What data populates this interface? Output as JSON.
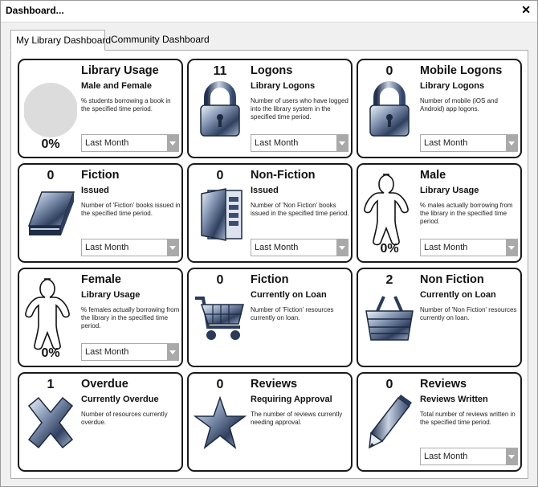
{
  "window": {
    "title": "Dashboard...",
    "close_glyph": "✕"
  },
  "tabs": [
    {
      "label": "My Library Dashboard",
      "active": true
    },
    {
      "label": "Community Dashboard",
      "active": false
    }
  ],
  "colors": {
    "card_border": "#1a1a1a",
    "icon_steel": "#3a4d6e",
    "pie_gray": "#dcdcdc",
    "dropdown_button": "#a9a9a9"
  },
  "cards": [
    {
      "title": "Library Usage",
      "subtitle": "Male and Female",
      "description": "% students borrowing a book in the specified time period.",
      "percent": "0%",
      "icon": "pie-chart-icon",
      "dropdown": "Last Month"
    },
    {
      "title": "Logons",
      "subtitle": "Library Logons",
      "description": "Number of users who have logged into the library system in the specified time period.",
      "count": "11",
      "icon": "padlock-icon",
      "dropdown": "Last Month"
    },
    {
      "title": "Mobile Logons",
      "subtitle": "Library Logons",
      "description": "Number of mobile (iOS and Android) app logons.",
      "count": "0",
      "icon": "padlock-icon",
      "dropdown": "Last Month"
    },
    {
      "title": "Fiction",
      "subtitle": "Issued",
      "description": "Number of 'Fiction' books issued in the specified time period.",
      "count": "0",
      "icon": "book-icon",
      "dropdown": "Last Month"
    },
    {
      "title": "Non-Fiction",
      "subtitle": "Issued",
      "description": "Number of 'Non Fiction' books issued in the specified time period.",
      "count": "0",
      "icon": "binder-icon",
      "dropdown": "Last Month"
    },
    {
      "title": "Male",
      "subtitle": "Library Usage",
      "description": "% males actually borrowing from the library in the specified time period.",
      "percent": "0%",
      "icon": "person-outline-icon",
      "dropdown": "Last Month"
    },
    {
      "title": "Female",
      "subtitle": "Library Usage",
      "description": "% females actually borrowing from the library in the specified time period.",
      "percent": "0%",
      "icon": "person-outline-icon",
      "dropdown": "Last Month"
    },
    {
      "title": "Fiction",
      "subtitle": "Currently on Loan",
      "description": "Number of 'Fiction' resources currently on loan.",
      "count": "0",
      "icon": "shopping-cart-icon"
    },
    {
      "title": "Non Fiction",
      "subtitle": "Currently on Loan",
      "description": "Number of 'Non Fiction' resources currently on loan.",
      "count": "2",
      "icon": "basket-icon"
    },
    {
      "title": "Overdue",
      "subtitle": "Currently Overdue",
      "description": "Number of resources currently overdue.",
      "count": "1",
      "icon": "x-cross-icon"
    },
    {
      "title": "Reviews",
      "subtitle": "Requiring Approval",
      "description": "The number of reviews currently needing approval.",
      "count": "0",
      "icon": "star-icon"
    },
    {
      "title": "Reviews",
      "subtitle": "Reviews Written",
      "description": "Total number of reviews written in the specified time period.",
      "count": "0",
      "icon": "pencil-icon",
      "dropdown": "Last Month"
    }
  ]
}
